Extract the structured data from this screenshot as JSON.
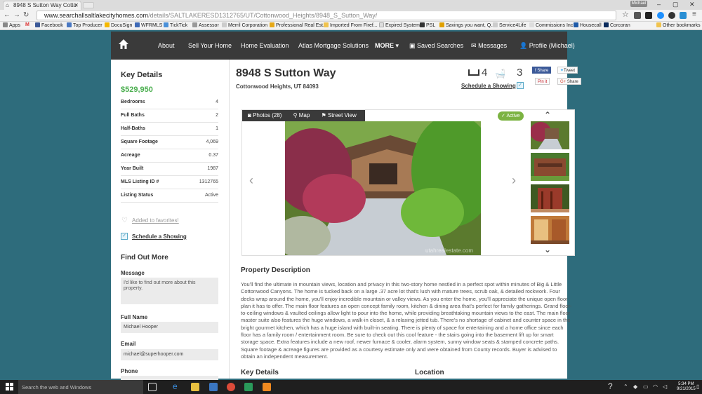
{
  "browser": {
    "tab_title": "8948 S Sutton Way Cotto",
    "user_badge": "Michael",
    "url_host": "www.searchallsaltlakecityhomes.com",
    "url_path": "/details/SALTLAKERESD1312765/UT/Cottonwood_Heights/8948_S_Sutton_Way/",
    "bookmarks": [
      "Apps",
      "Facebook",
      "DocuSign",
      "WFRMLS",
      "TickTick",
      "Assessor",
      "Merril Corporation",
      "Professional Real Est...",
      "Imported From Firef...",
      "Expired System",
      "PSL",
      "Savings you want, Q...",
      "Service4Life",
      "Commissions Inc",
      "Housecall",
      "Corcoran",
      "Other bookmarks"
    ]
  },
  "site_nav": {
    "items": [
      "About",
      "Sell Your Home",
      "Home Evaluation",
      "Atlas Mortgage Solutions",
      "MORE",
      "Saved Searches",
      "Messages",
      "Profile (Michael)"
    ]
  },
  "key_details": {
    "heading": "Key Details",
    "price": "$529,950",
    "rows": [
      {
        "label": "Bedrooms",
        "value": "4"
      },
      {
        "label": "Full Baths",
        "value": "2"
      },
      {
        "label": "Half-Baths",
        "value": "1"
      },
      {
        "label": "Square Footage",
        "value": "4,069"
      },
      {
        "label": "Acreage",
        "value": "0.37"
      },
      {
        "label": "Year Built",
        "value": "1987"
      },
      {
        "label": "MLS Listing ID #",
        "value": "1312765"
      },
      {
        "label": "Listing Status",
        "value": "Active"
      }
    ],
    "favorites_label": "Added to favorites!",
    "schedule_label": "Schedule a Showing"
  },
  "find_out_more": {
    "heading": "Find Out More",
    "message_label": "Message",
    "message_value": "I'd like to find out more about this property.",
    "full_name_label": "Full Name",
    "full_name_value": "Michael Hooper",
    "email_label": "Email",
    "email_value": "michael@superhooper.com",
    "phone_label": "Phone"
  },
  "listing": {
    "address": "8948 S Sutton Way",
    "city_line": "Cottonwood Heights, UT 84093",
    "beds": "4",
    "baths": "3",
    "schedule_label": "Schedule a Showing",
    "share": {
      "facebook": "Share",
      "twitter": "Tweet",
      "pinterest": "Pin it",
      "google": "Share"
    }
  },
  "gallery": {
    "tabs": [
      "Photos (28)",
      "Map",
      "Street View"
    ],
    "status": "Active",
    "watermark": "utahrealestate.com"
  },
  "description": {
    "heading": "Property Description",
    "text": "You'll find the ultimate in mountain views, location and privacy in this two-story home nestled in a perfect spot within minutes of Big & Little Cottonwood Canyons. The home is tucked back on a large .37 acre lot that's lush with mature trees, scrub oak, & detailed rockwork. Four decks wrap around the home, you'll enjoy incredible mountain or valley views. As you enter the home, you'll appreciate the unique open floor plan it has to offer. The main floor features an open concept family room, kitchen & dining area that's perfect for family gatherings. Grand floor-to-ceiling windows & vaulted ceilings allow light to pour into the home, while providing breathtaking mountain views to the east. The main floor master suite also features the huge windows, a walk-in closet, & a relaxing jetted tub. There's no shortage of cabinet and counter space in the bright gourmet kitchen, which has a huge island with built-in seating. There is plenty of space for entertaining and a home office since each floor has a family room / entertainment room. Be sure to check out this cool feature - the stairs going into the basement lift up for smart storage space. Extra features include a new roof, newer furnace & cooler, alarm system, sunny window seats & stamped concrete paths. Square footage & acreage figures are provided as a courtesy estimate only and were obtained from County records. Buyer is advised to obtain an independent measurement.",
    "key_details_heading": "Key Details",
    "location_heading": "Location"
  },
  "taskbar": {
    "search_placeholder": "Search the web and Windows",
    "time": "5:34 PM",
    "date": "9/21/2015"
  }
}
